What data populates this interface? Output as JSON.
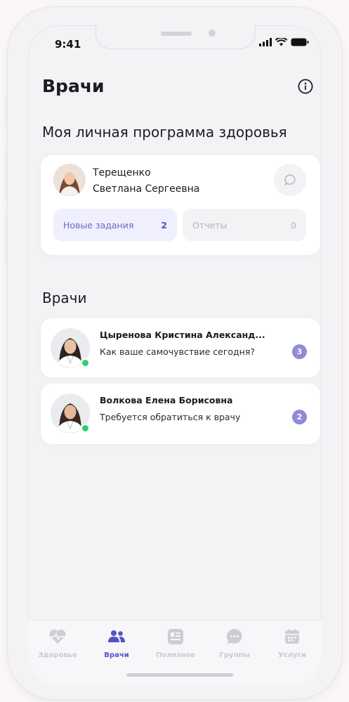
{
  "status_bar": {
    "time": "9:41"
  },
  "header": {
    "title": "Врачи"
  },
  "program": {
    "section_title": "Моя личная программа здоровья",
    "patient_name_line1": "Терещенко",
    "patient_name_line2": "Светлана Сергеевна",
    "chips": [
      {
        "label": "Новые задания",
        "count": "2"
      },
      {
        "label": "Отчеты",
        "count": "0"
      }
    ]
  },
  "doctors": {
    "section_title": "Врачи",
    "items": [
      {
        "name": "Цыренова Кристина Александ...",
        "message": "Как ваше самочувствие сегодня?",
        "unread": "3"
      },
      {
        "name": "Волкова Елена Борисовна",
        "message": "Требуется обратиться к врачу",
        "unread": "2"
      }
    ]
  },
  "tabbar": {
    "tabs": [
      {
        "label": "Здоровье",
        "icon": "heart-pulse-icon"
      },
      {
        "label": "Врачи",
        "icon": "people-icon"
      },
      {
        "label": "Полезное",
        "icon": "article-icon"
      },
      {
        "label": "Группы",
        "icon": "chat-bubble-icon"
      },
      {
        "label": "Услуги",
        "icon": "calendar-icon"
      }
    ],
    "active_index": 1
  },
  "colors": {
    "accent": "#5552c8",
    "badge": "#8f8bd6",
    "online": "#28d46a",
    "chip_active_bg": "#efeffd"
  }
}
